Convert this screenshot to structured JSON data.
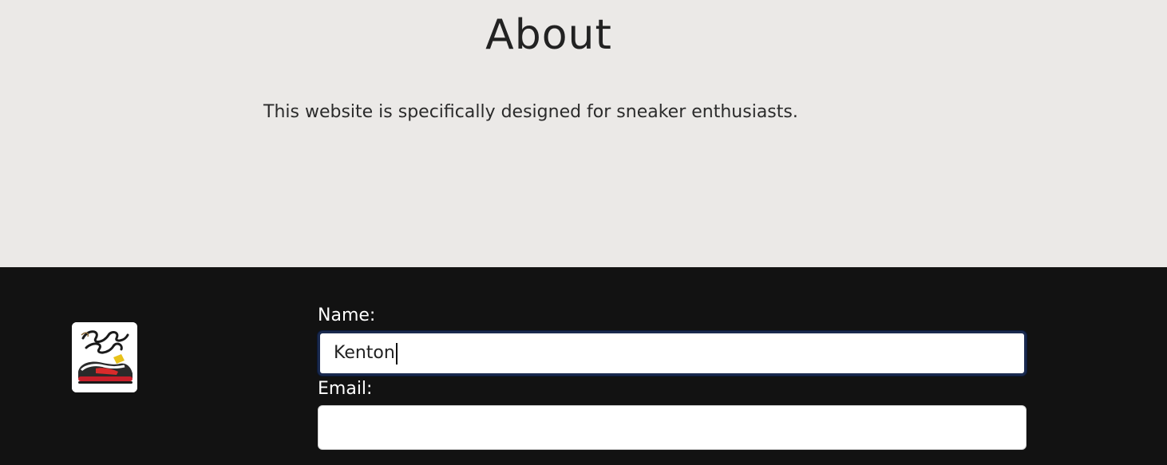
{
  "about": {
    "title": "About",
    "description": "This website is specifically designed for sneaker enthusiasts."
  },
  "footer": {
    "logo": {
      "icon": "sneaker-ready-logo"
    },
    "form": {
      "name_label": "Name:",
      "name_value": "Kenton",
      "email_label": "Email:",
      "email_value": ""
    }
  },
  "colors": {
    "about_bg": "#ebe9e7",
    "footer_bg": "#121212",
    "focus_ring": "#1a2a4f"
  }
}
